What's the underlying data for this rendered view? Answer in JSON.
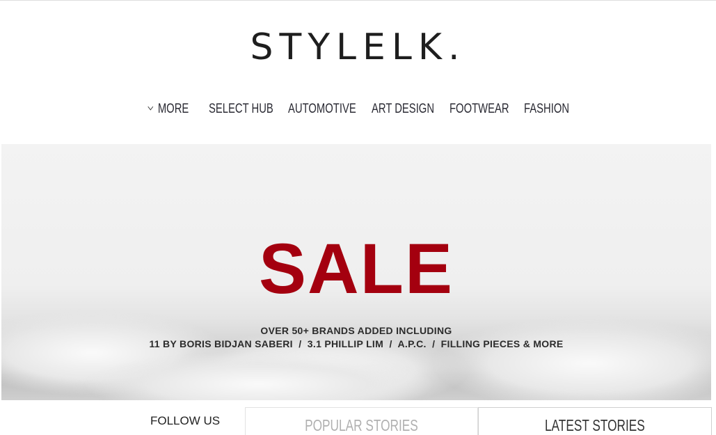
{
  "site": {
    "logo": "STYLELK."
  },
  "nav": {
    "items": [
      {
        "label": "MORE",
        "icon": "chevron-down-icon"
      },
      {
        "label": "SELECT HUB"
      },
      {
        "label": "AUTOMOTIVE"
      },
      {
        "label": "ART DESIGN"
      },
      {
        "label": "FOOTWEAR"
      },
      {
        "label": "FASHION"
      }
    ]
  },
  "banner": {
    "headline": "SALE",
    "line1": "OVER 50+ BRANDS ADDED INCLUDING",
    "line2": "11 BY BORIS BIDJAN SABERI  /  3.1 PHILLIP LIM  /  A.P.C.  /  FILLING PIECES & MORE",
    "headline_color": "#a4000f"
  },
  "footer": {
    "follow_label": "FOLLOW US",
    "tabs": [
      {
        "label": "POPULAR STORIES",
        "active": false
      },
      {
        "label": "LATEST STORIES",
        "active": true
      }
    ]
  }
}
